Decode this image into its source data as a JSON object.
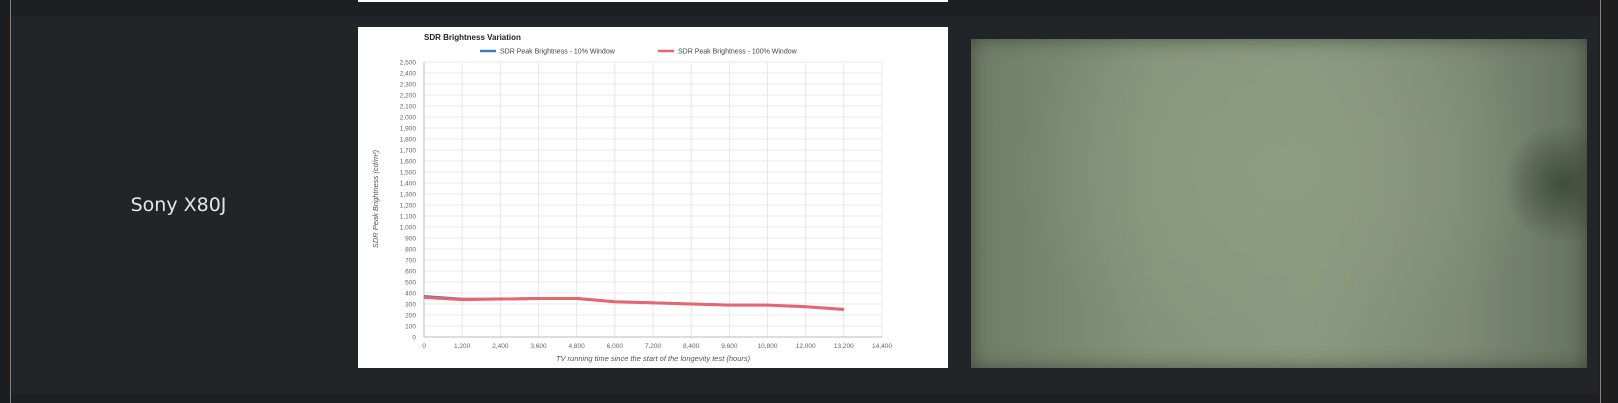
{
  "row": {
    "label": "Sony X80J"
  },
  "chart_data": {
    "type": "line",
    "title": "SDR Brightness Variation",
    "xlabel": "TV running time since the start of the longevity test (hours)",
    "ylabel": "SDR Peak Brightness (cd/m²)",
    "xlim": [
      0,
      14400
    ],
    "ylim": [
      0,
      2500
    ],
    "xticks": [
      0,
      1200,
      2400,
      3600,
      4800,
      6000,
      7200,
      8400,
      9600,
      10800,
      12000,
      13200,
      14400
    ],
    "xtick_labels": [
      "0",
      "1,200",
      "2,400",
      "3,600",
      "4,800",
      "6,000",
      "7,200",
      "8,400",
      "9,600",
      "10,800",
      "12,000",
      "13,200",
      "14,400"
    ],
    "yticks": [
      0,
      100,
      200,
      300,
      400,
      500,
      600,
      700,
      800,
      900,
      1000,
      1100,
      1200,
      1300,
      1400,
      1500,
      1600,
      1700,
      1800,
      1900,
      2000,
      2100,
      2200,
      2300,
      2400,
      2500
    ],
    "ytick_labels": [
      "0",
      "100",
      "200",
      "300",
      "400",
      "500",
      "600",
      "700",
      "800",
      "900",
      "1,000",
      "1,100",
      "1,200",
      "1,300",
      "1,400",
      "1,500",
      "1,600",
      "1,700",
      "1,800",
      "1,900",
      "2,000",
      "2,100",
      "2,200",
      "2,300",
      "2,400",
      "2,500"
    ],
    "grid": true,
    "legend_position": "top",
    "x": [
      0,
      1200,
      2400,
      3600,
      4800,
      6000,
      7200,
      8400,
      9600,
      10800,
      12000,
      13200
    ],
    "series": [
      {
        "name": "SDR Peak Brightness - 10% Window",
        "color": "#3a7fc1",
        "values": [
          370,
          345,
          345,
          352,
          352,
          322,
          312,
          300,
          292,
          290,
          276,
          252
        ]
      },
      {
        "name": "SDR Peak Brightness - 100% Window",
        "color": "#e8646e",
        "values": [
          360,
          340,
          345,
          350,
          350,
          320,
          310,
          300,
          290,
          290,
          275,
          250
        ]
      }
    ]
  }
}
